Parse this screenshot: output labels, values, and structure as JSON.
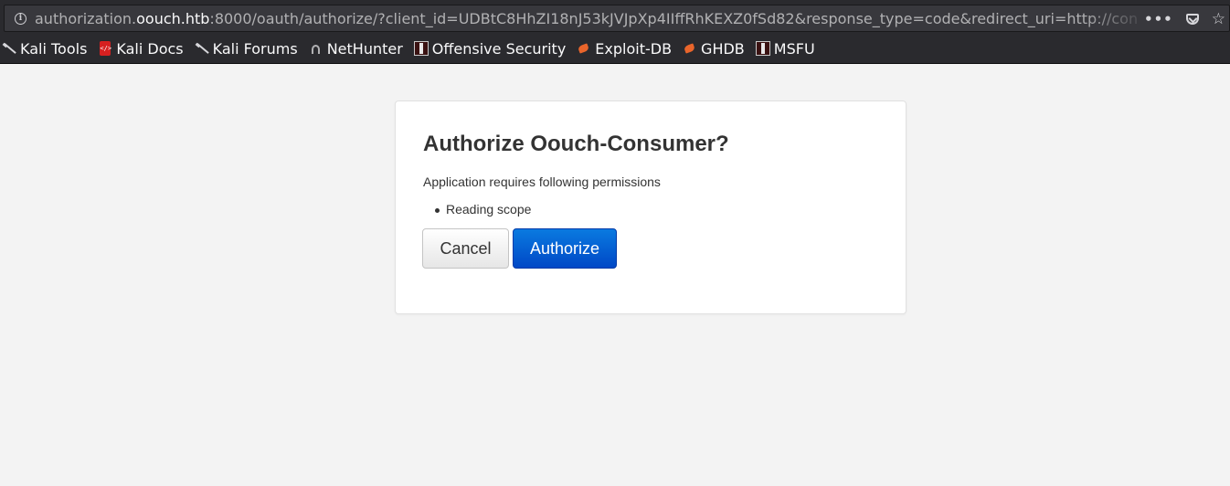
{
  "browser": {
    "url_prefix": "authorization.",
    "url_host": "oouch.htb",
    "url_rest": ":8000/oauth/authorize/?client_id=UDBtC8HhZI18nJ53kJVJpXp4IIffRhKEXZ0fSd82&response_type=code&redirect_uri=http://con",
    "actions": [
      "page-actions-menu-icon",
      "pocket-icon",
      "bookmark-star-icon"
    ]
  },
  "bookmarks": [
    {
      "label": "Kali Tools",
      "icon": "kali-dragon-icon"
    },
    {
      "label": "Kali Docs",
      "icon": "kali-docs-icon"
    },
    {
      "label": "Kali Forums",
      "icon": "kali-dragon-icon"
    },
    {
      "label": "NetHunter",
      "icon": "nethunter-icon"
    },
    {
      "label": "Offensive Security",
      "icon": "offsec-icon"
    },
    {
      "label": "Exploit-DB",
      "icon": "exploit-db-icon"
    },
    {
      "label": "GHDB",
      "icon": "exploit-db-icon"
    },
    {
      "label": "MSFU",
      "icon": "offsec-icon"
    }
  ],
  "auth": {
    "title": "Authorize Oouch-Consumer?",
    "requirement_text": "Application requires following permissions",
    "permissions": [
      "Reading scope"
    ],
    "cancel_label": "Cancel",
    "authorize_label": "Authorize"
  }
}
